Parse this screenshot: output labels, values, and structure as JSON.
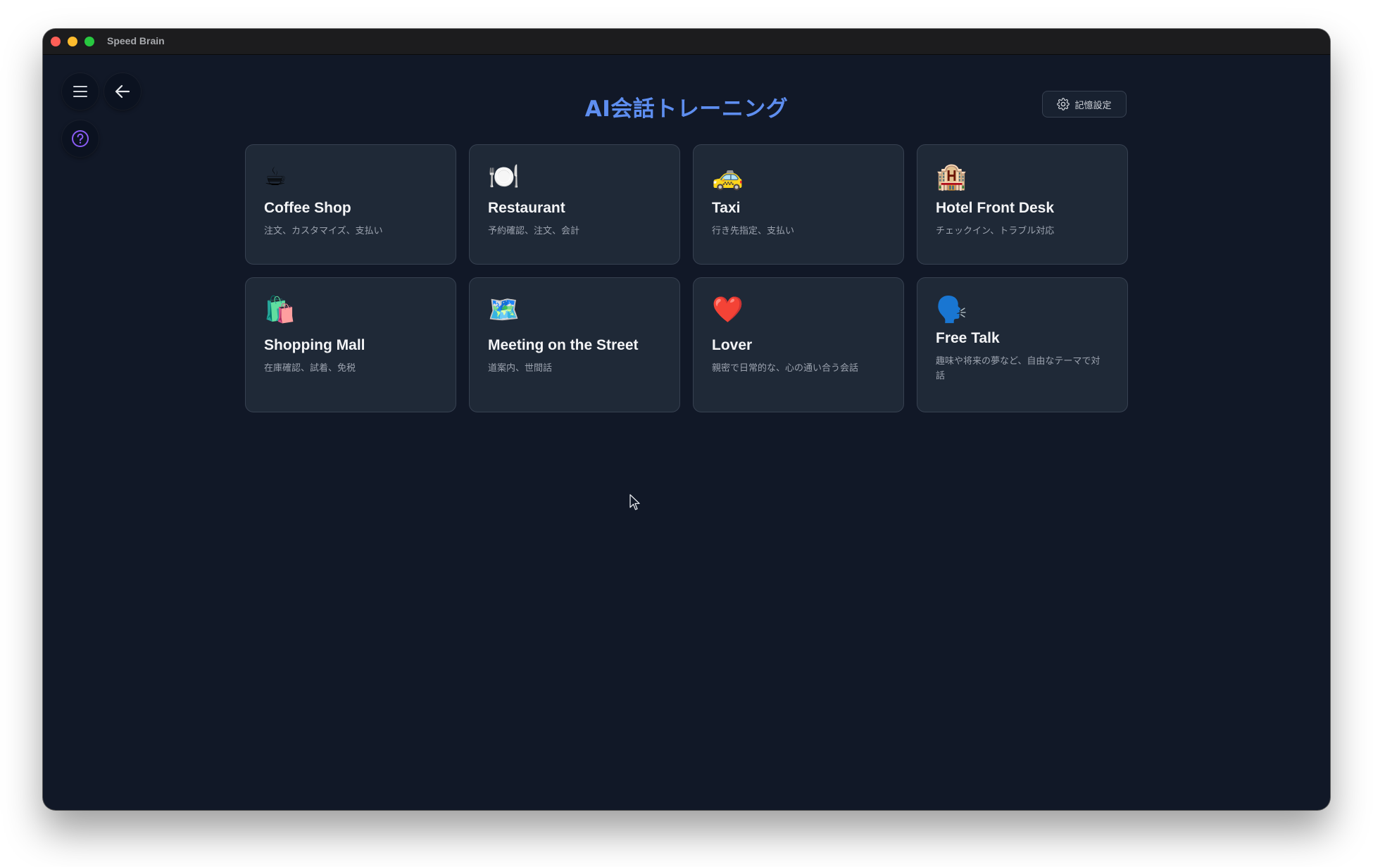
{
  "window": {
    "app_title": "Speed Brain"
  },
  "nav": {
    "menu_icon": "hamburger-menu-icon",
    "back_icon": "arrow-left-icon",
    "help_icon": "question-circle-icon"
  },
  "header": {
    "title": "AI会話トレーニング",
    "memory_settings_label": "記憶設定",
    "memory_settings_icon": "gear-icon"
  },
  "scenarios": [
    {
      "emoji": "☕",
      "icon": "coffee-cup-icon",
      "title": "Coffee Shop",
      "description": "注文、カスタマイズ、支払い"
    },
    {
      "emoji": "🍽️",
      "icon": "plate-cutlery-icon",
      "title": "Restaurant",
      "description": "予約確認、注文、会計"
    },
    {
      "emoji": "🚕",
      "icon": "taxi-icon",
      "title": "Taxi",
      "description": "行き先指定、支払い"
    },
    {
      "emoji": "🏨",
      "icon": "hotel-icon",
      "title": "Hotel Front Desk",
      "description": "チェックイン、トラブル対応"
    },
    {
      "emoji": "🛍️",
      "icon": "shopping-bags-icon",
      "title": "Shopping Mall",
      "description": "在庫確認、試着、免税"
    },
    {
      "emoji": "🗺️",
      "icon": "map-icon",
      "title": "Meeting on the Street",
      "description": "道案内、世間話"
    },
    {
      "emoji": "❤️",
      "icon": "heart-icon",
      "title": "Lover",
      "description": "親密で日常的な、心の通い合う会話"
    },
    {
      "emoji": "🗣️",
      "icon": "speaking-head-icon",
      "title": "Free Talk",
      "description": "趣味や将来の夢など、自由なテーマで対話"
    }
  ],
  "colors": {
    "background": "#111827",
    "card": "#1f2937",
    "title_accent": "#5e8ef0",
    "help_accent": "#8b5cf6"
  }
}
